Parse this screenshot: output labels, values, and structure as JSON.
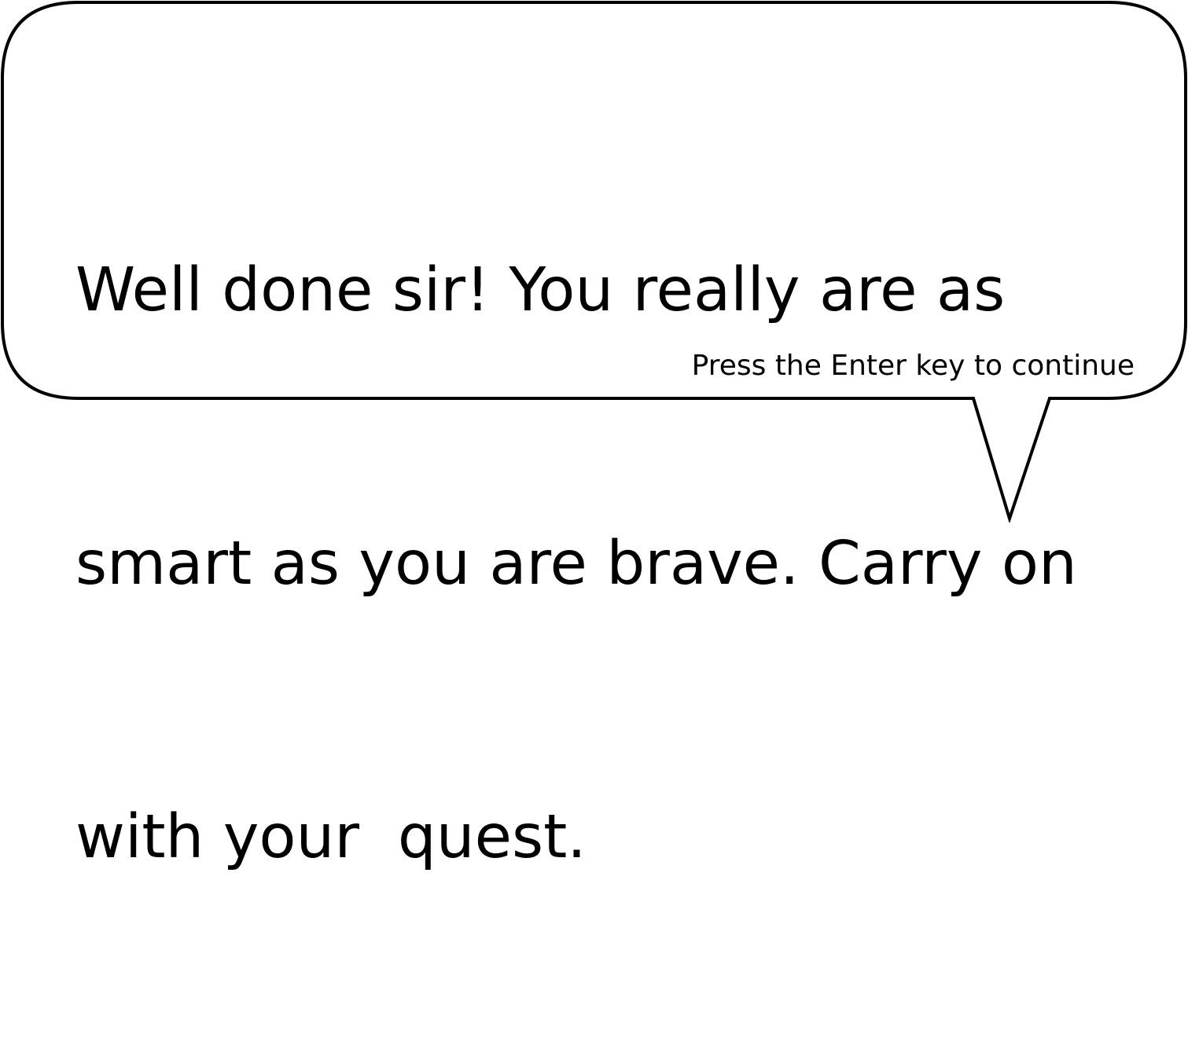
{
  "dialogue": {
    "lines": [
      "Well done sir! You really are as",
      "smart as you are brave. Carry on",
      "with your  quest."
    ],
    "continue_prompt": "Press the Enter key to continue"
  },
  "colors": {
    "background": "#ffffff",
    "bubble_fill": "#ffffff",
    "bubble_stroke": "#000000",
    "text": "#000000"
  }
}
